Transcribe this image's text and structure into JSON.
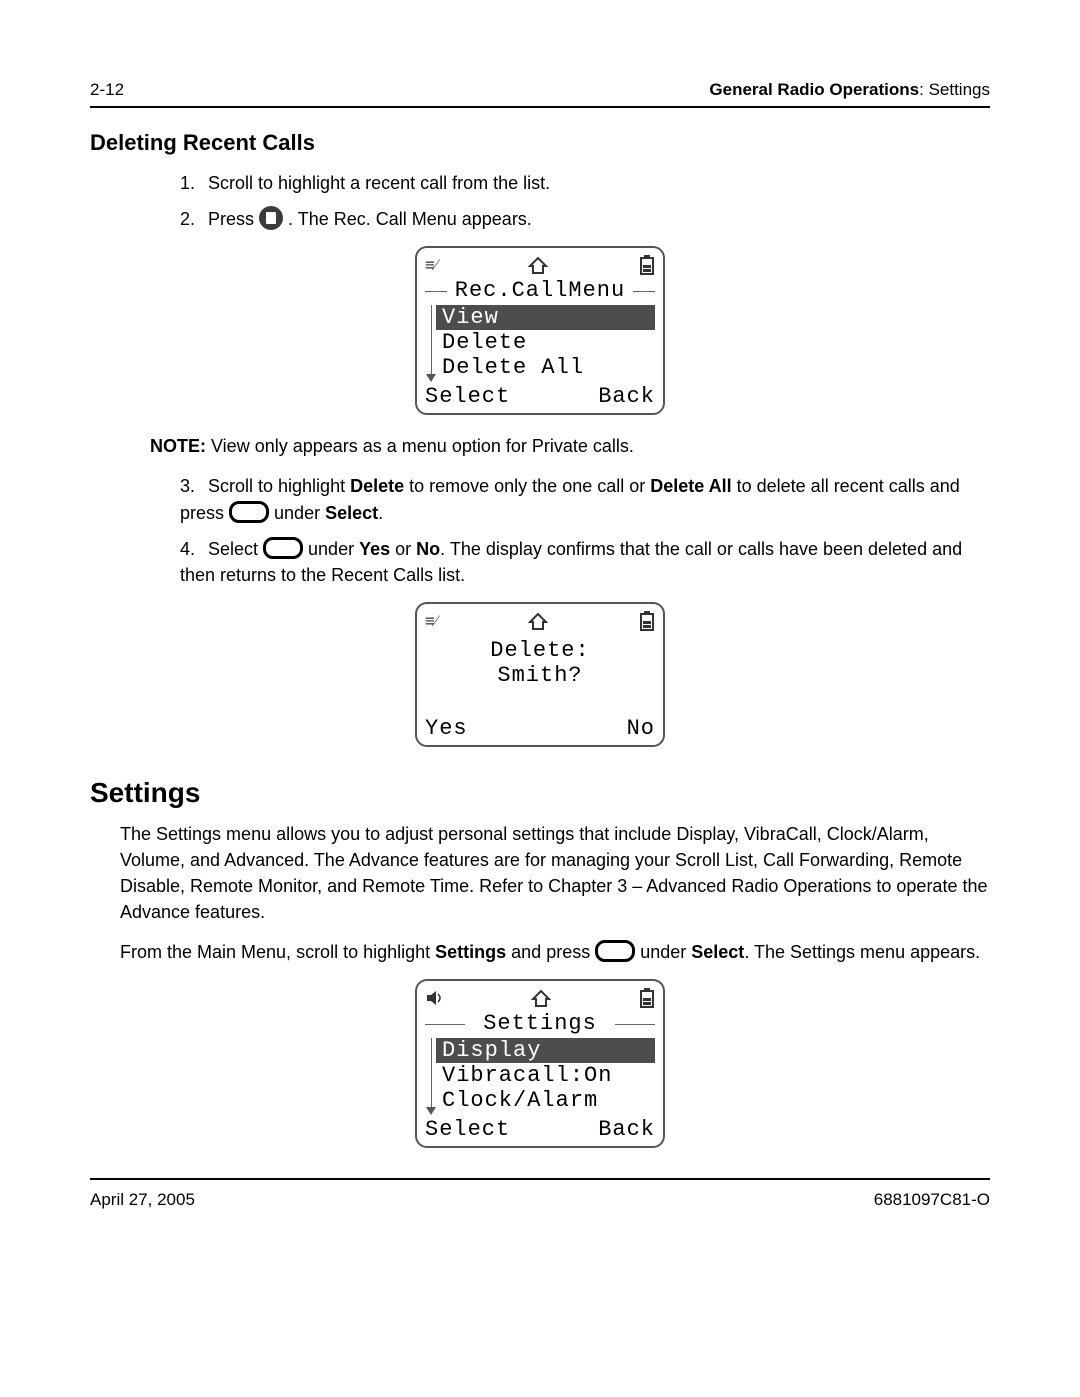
{
  "header": {
    "page": "2-12",
    "section_bold": "General Radio Operations",
    "section_rest": ": Settings"
  },
  "h_delete": "Deleting Recent Calls",
  "steps_a": [
    {
      "label": "1.",
      "text": "Scroll to highlight a recent call from the list."
    },
    {
      "label": "2.",
      "pre": "Press ",
      "post": " . The Rec. Call Menu appears."
    }
  ],
  "screen1": {
    "title": "Rec.CallMenu",
    "items": [
      "View",
      "Delete",
      "Delete All"
    ],
    "soft_left": "Select",
    "soft_right": "Back"
  },
  "note": {
    "bold": "NOTE:",
    "text": " View only appears as a menu option for Private calls."
  },
  "steps_b": [
    {
      "label": "3.",
      "p1": "Scroll to highlight ",
      "b1": "Delete",
      "p2": " to remove only the one call or ",
      "b2": "Delete All",
      "p3": " to delete all recent calls and press ",
      "p4": " under ",
      "b3": "Select",
      "p5": "."
    },
    {
      "label": "4.",
      "p1": "Select ",
      "p2": " under ",
      "b1": "Yes",
      "p3": " or ",
      "b2": "No",
      "p4": ". The display confirms that the call or calls have been deleted and then returns to the Recent Calls list."
    }
  ],
  "screen2": {
    "line1": "Delete:",
    "line2": "Smith?",
    "soft_left": "Yes",
    "soft_right": "No"
  },
  "h_settings": "Settings",
  "settings_para": "The Settings menu allows you to adjust personal settings that include Display, VibraCall, Clock/Alarm, Volume, and Advanced. The Advance features are for managing your Scroll List, Call Forwarding, Remote Disable, Remote Monitor, and Remote Time. Refer to Chapter 3 – Advanced Radio Operations to operate the Advance features.",
  "settings_nav": {
    "p1": "From the Main Menu, scroll to highlight ",
    "b1": "Settings",
    "p2": " and press ",
    "p3": " under ",
    "b2": "Select",
    "p4": ". The Settings menu appears."
  },
  "screen3": {
    "title": "Settings",
    "items": [
      "Display",
      "Vibracall:On",
      "Clock/Alarm"
    ],
    "soft_left": "Select",
    "soft_right": "Back"
  },
  "footer": {
    "date": "April 27, 2005",
    "doc": "6881097C81-O"
  }
}
